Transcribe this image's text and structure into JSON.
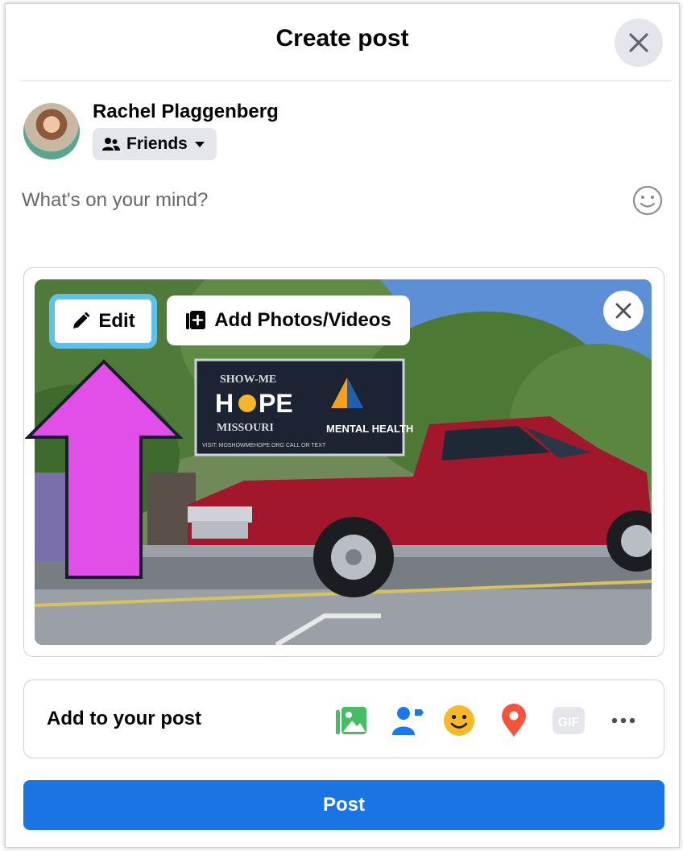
{
  "dialog": {
    "title": "Create post"
  },
  "user": {
    "name": "Rachel Plaggenberg",
    "audience": "Friends"
  },
  "composer": {
    "placeholder": "What's on your mind?"
  },
  "media": {
    "edit_label": "Edit",
    "add_label": "Add Photos/Videos",
    "sign_line1": "SHOW-ME",
    "sign_line2_a": "H",
    "sign_line2_b": "PE",
    "sign_line3": "MISSOURI",
    "sign_right": "MENTAL HEALTH",
    "sign_bottom": "VISIT: MOSHOWMEHOPE.ORG    CALL OR TEXT"
  },
  "add_to_post": {
    "label": "Add to your post",
    "tools": [
      "photo-video-icon",
      "tag-people-icon",
      "feeling-icon",
      "location-pin-icon",
      "gif-icon",
      "more-icon"
    ],
    "gif_text": "GIF"
  },
  "footer": {
    "post_label": "Post"
  },
  "colors": {
    "primary": "#1b74e4",
    "highlight_border": "#5ec1ea",
    "arrow_fill": "#e04fe8",
    "photo_icon": "#45bd62",
    "tag_icon": "#1877f2",
    "feeling_icon": "#f7b928",
    "location_icon": "#f5533d"
  }
}
